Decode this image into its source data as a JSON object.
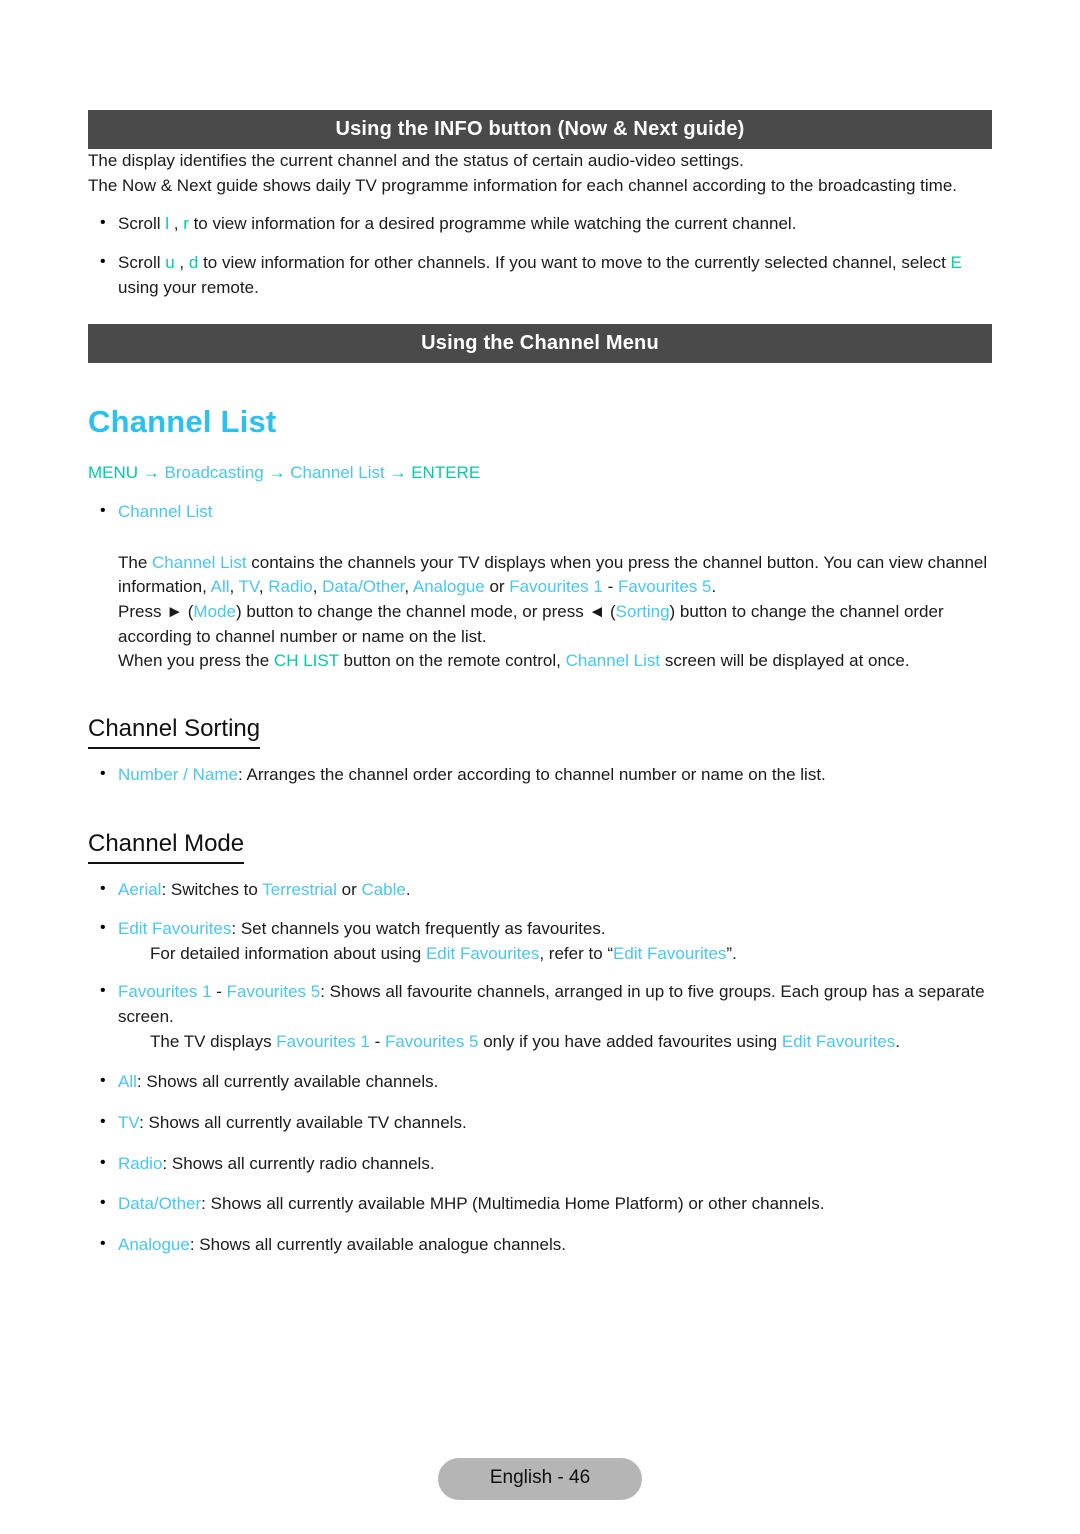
{
  "colors": {
    "bar_bg": "#4a4a4a",
    "bar_text": "#ffffff",
    "accent_cyan": "#45c8f5",
    "accent_teal": "#00cda5",
    "title_cyan": "#29c1f2",
    "footer_pill": "#b5b5b5",
    "body_text": "#1a1a1a"
  },
  "section_info": {
    "bar_title": "Using the INFO button (Now & Next guide)",
    "paragraph_1": "The display identifies the current channel and the status of certain audio-video settings.",
    "paragraph_2": "The Now & Next guide shows daily TV programme information for each channel according to the broadcasting time.",
    "bullets": [
      {
        "pre": "Scroll ",
        "key1": "l",
        "mid": " , ",
        "key2": "r",
        "post": " to view information for a desired programme while watching the current channel."
      },
      {
        "pre": "Scroll ",
        "key1": "u",
        "mid": " , ",
        "key2": "d",
        "post": " to view information for other channels. If you want to move to the currently selected channel, select ",
        "key3": "E",
        "tail": " using your remote."
      }
    ]
  },
  "section_channel_menu": {
    "bar_title": "Using the Channel Menu",
    "title": "Channel List",
    "menu_path": {
      "menu": "MENU",
      "arrow": "→",
      "step1": "Broadcasting",
      "step2": "Channel List",
      "enter": "ENTERE"
    },
    "menu_bullet": "Channel List",
    "para_1": {
      "t1": "The ",
      "c1": "Channel List",
      "t2": " contains the channels your TV displays when you press the channel button. You can view channel information, ",
      "c2": "All",
      "t3": ", ",
      "c3": "TV",
      "t4": ", ",
      "c4": "Radio",
      "t5": ", ",
      "c5": "Data/Other",
      "t6": ", ",
      "c6": "Analogue",
      "t7": " or ",
      "c7": "Favourites 1",
      "t8": " - ",
      "c8": "Favourites 5",
      "t9": "."
    },
    "para_2": {
      "t1": "Press ",
      "glyph1": "►",
      "t2": " (",
      "c1": "Mode",
      "t3": ") button to change the channel mode, or press ",
      "glyph2": "◄",
      "t4": " (",
      "c2": "Sorting",
      "t5": ") button to change the channel order according to channel number or name on the list."
    },
    "para_3": {
      "t1": "When you press the ",
      "k1": "CH LIST",
      "t2": " button on the remote control, ",
      "c1": "Channel List",
      "t3": " screen will be displayed at once."
    }
  },
  "section_channel_sorting": {
    "heading": "Channel Sorting",
    "bullets": [
      {
        "label": "Number / Name",
        "text": ": Arranges the channel order according to channel number or name on the list."
      }
    ]
  },
  "section_channel_mode": {
    "heading": "Channel Mode",
    "item_aerial": {
      "label": "Aerial",
      "t1": ": Switches to ",
      "c1": "Terrestrial",
      "t2": " or ",
      "c2": "Cable",
      "t3": "."
    },
    "item_edit_fav": {
      "label": "Edit Favourites",
      "text": ": Set channels you watch frequently as favourites."
    },
    "sub_edit_fav": {
      "t1": "For detailed information about using ",
      "c1": "Edit Favourites",
      "t2": ", refer to “",
      "c2": "Edit Favourites",
      "t3": "”."
    },
    "item_favourites": {
      "c1": "Favourites 1",
      "t1": " - ",
      "c2": "Favourites 5",
      "t2": ": Shows all favourite channels, arranged in up to five groups. Each group has a separate screen."
    },
    "sub_favourites": {
      "t1": "The TV displays ",
      "c1": "Favourites 1",
      "t2": " - ",
      "c2": "Favourites 5",
      "t3": " only if you have added favourites using ",
      "c3": "Edit Favourites",
      "t4": "."
    },
    "simple_items": [
      {
        "label": "All",
        "text": ": Shows all currently available channels."
      },
      {
        "label": "TV",
        "text": ": Shows all currently available TV channels."
      },
      {
        "label": "Radio",
        "text": ": Shows all currently radio channels."
      },
      {
        "label": "Data/Other",
        "text": ": Shows all currently available MHP (Multimedia Home Platform) or other channels."
      },
      {
        "label": "Analogue",
        "text": ": Shows all currently available analogue channels."
      }
    ]
  },
  "footer": {
    "label": "English - 46"
  }
}
